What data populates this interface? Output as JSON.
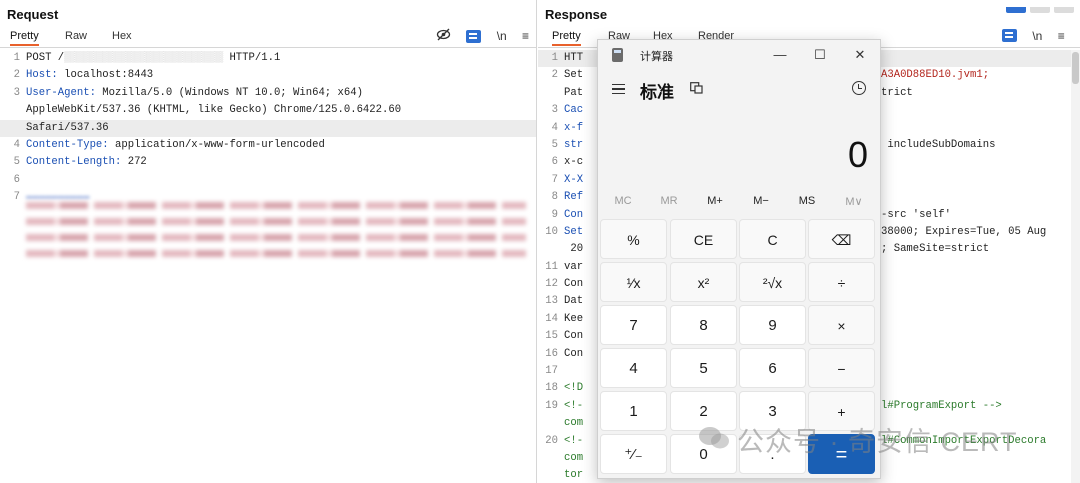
{
  "request": {
    "title": "Request",
    "tabs": [
      "Pretty",
      "Raw",
      "Hex"
    ],
    "icons": [
      "eye-off-icon",
      "wrap-icon",
      "newline-icon",
      "menu-icon"
    ],
    "newline_label": "\\n",
    "menu_glyph": "≡",
    "line_numbers": [
      "1",
      "2",
      "3",
      "",
      "",
      "4",
      "5",
      "6",
      "7"
    ],
    "line1_method": "POST /",
    "line1_end": "HTTP/1.1",
    "line2_key": "Host:",
    "line2_val": " localhost:8443",
    "line3_key": "User-Agent:",
    "line3_val": " Mozilla/5.0 (Windows NT 10.0; Win64; x64)",
    "line3b": "AppleWebKit/537.36 (KHTML, like Gecko) Chrome/125.0.6422.60",
    "line3c": "Safari/537.36",
    "line4_key": "Content-Type:",
    "line4_val": " application/x-www-form-urlencoded",
    "line5_key": "Content-Length:",
    "line5_val": " 272"
  },
  "response": {
    "title": "Response",
    "tabs": [
      "Pretty",
      "Raw",
      "Hex",
      "Render"
    ],
    "newline_label": "\\n",
    "menu_glyph": "≡",
    "line_numbers": [
      "1",
      "2",
      "",
      "3",
      "4",
      "5",
      "6",
      "7",
      "8",
      "9",
      "10",
      "",
      "11",
      "12",
      "13",
      "14",
      "15",
      "16",
      "17",
      "18",
      "19",
      "",
      "20",
      "",
      ""
    ],
    "lines": [
      "HTT",
      "Set",
      "Pat",
      "Cac",
      "x-f",
      "str",
      "x-c",
      "X-X",
      "Ref",
      "Con",
      "Set",
      " 20",
      "var",
      "Con",
      "Dat",
      "Kee",
      "Con",
      "Con",
      "",
      "<!D",
      "<!-",
      "com",
      "<!-",
      "com",
      "tor"
    ],
    "right_fragments": {
      "r2": "A3A0D88ED10.jvm1;",
      "r2b": "trict",
      "r5": " includeSubDomains",
      "r9": "-src 'self'",
      "r10": "38000; Expires=Tue, 05 Aug",
      "r10b": "; SameSite=strict",
      "r19": "l#ProgramExport -->",
      "r20": "l#CommonImportExportDecora",
      "r20b": "->"
    }
  },
  "calculator": {
    "title": "计算器",
    "mode": "标准",
    "display": "0",
    "window_buttons": [
      "—",
      "☐",
      "✕"
    ],
    "memory": [
      "MC",
      "MR",
      "M+",
      "M−",
      "MS",
      "M∨"
    ],
    "keys": [
      [
        "%",
        "CE",
        "C",
        "⌫"
      ],
      [
        "¹⁄x",
        "x²",
        "²√x",
        "÷"
      ],
      [
        "7",
        "8",
        "9",
        "×"
      ],
      [
        "4",
        "5",
        "6",
        "−"
      ],
      [
        "1",
        "2",
        "3",
        "+"
      ],
      [
        "⁺⁄₋",
        "0",
        ".",
        "="
      ]
    ]
  },
  "watermark": "公众号 · 奇安信 CERT"
}
